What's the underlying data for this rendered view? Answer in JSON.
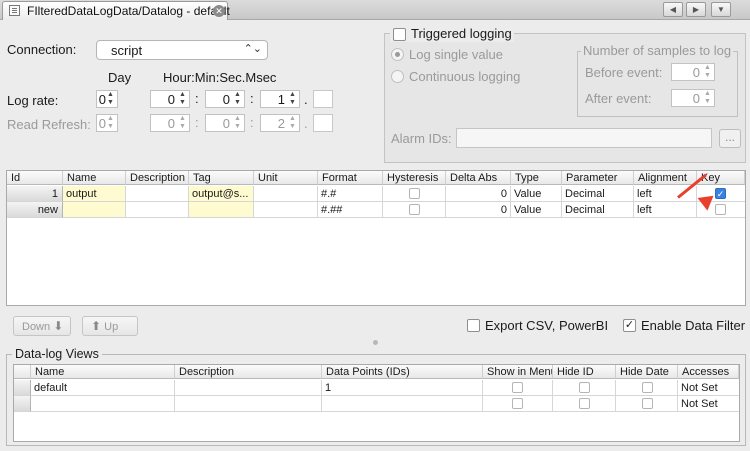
{
  "tab": {
    "title": "FIlteredDataLogData/Datalog - default",
    "close": "✕"
  },
  "nav": {
    "prev": "◀",
    "next": "▶",
    "menu": "▼"
  },
  "connection": {
    "label": "Connection:",
    "value": "script"
  },
  "time_headers": {
    "day": "Day",
    "hms": "Hour:Min:Sec.Msec"
  },
  "log_rate": {
    "label": "Log rate:",
    "day": "0",
    "hour": "0",
    "min": "0",
    "sec": "1",
    "msec": ""
  },
  "read_refresh": {
    "label": "Read Refresh:",
    "day": "0",
    "hour": "0",
    "min": "0",
    "sec": "2",
    "msec": ""
  },
  "separators": {
    "colon": ":",
    "dot": "."
  },
  "triggered": {
    "label": "Triggered logging",
    "single": "Log single value",
    "continuous": "Continuous logging",
    "samples_title": "Number of samples to log",
    "before_label": "Before event:",
    "before_value": "0",
    "after_label": "After event:",
    "after_value": "0",
    "alarm_label": "Alarm IDs:",
    "alarm_value": "",
    "dots": "..."
  },
  "points_table": {
    "headers": [
      "Id",
      "Name",
      "Description",
      "Tag",
      "Unit",
      "Format",
      "Hysteresis",
      "Delta Abs",
      "Type",
      "Parameter",
      "Alignment",
      "Key"
    ],
    "rows": [
      {
        "id": "1",
        "name": "output",
        "description": "",
        "tag": "output@s...",
        "unit": "",
        "format": "#.#",
        "hysteresis": false,
        "delta_abs": "0",
        "type": "Value",
        "parameter": "Decimal",
        "alignment": "left",
        "key": true
      },
      {
        "id": "new",
        "name": "",
        "description": "",
        "tag": "",
        "unit": "",
        "format": "#.##",
        "hysteresis": false,
        "delta_abs": "0",
        "type": "Value",
        "parameter": "Decimal",
        "alignment": "left",
        "key": false
      }
    ]
  },
  "actions": {
    "down": "Down",
    "up": "Up",
    "export": "Export CSV, PowerBI",
    "enable_filter": "Enable Data Filter",
    "export_checked": false,
    "enable_filter_checked": true
  },
  "views": {
    "title": "Data-log Views",
    "headers": [
      "Name",
      "Description",
      "Data Points (IDs)",
      "Show in Menu",
      "Hide ID",
      "Hide Date",
      "Accesses"
    ],
    "rows": [
      {
        "name": "default",
        "description": "",
        "points": "1",
        "accesses": "Not Set"
      },
      {
        "name": "",
        "description": "",
        "points": "",
        "accesses": "Not Set"
      }
    ]
  },
  "colors": {
    "accent": "#3b82e0",
    "annotation": "#e8402a",
    "highlight": "#fffbd0"
  }
}
